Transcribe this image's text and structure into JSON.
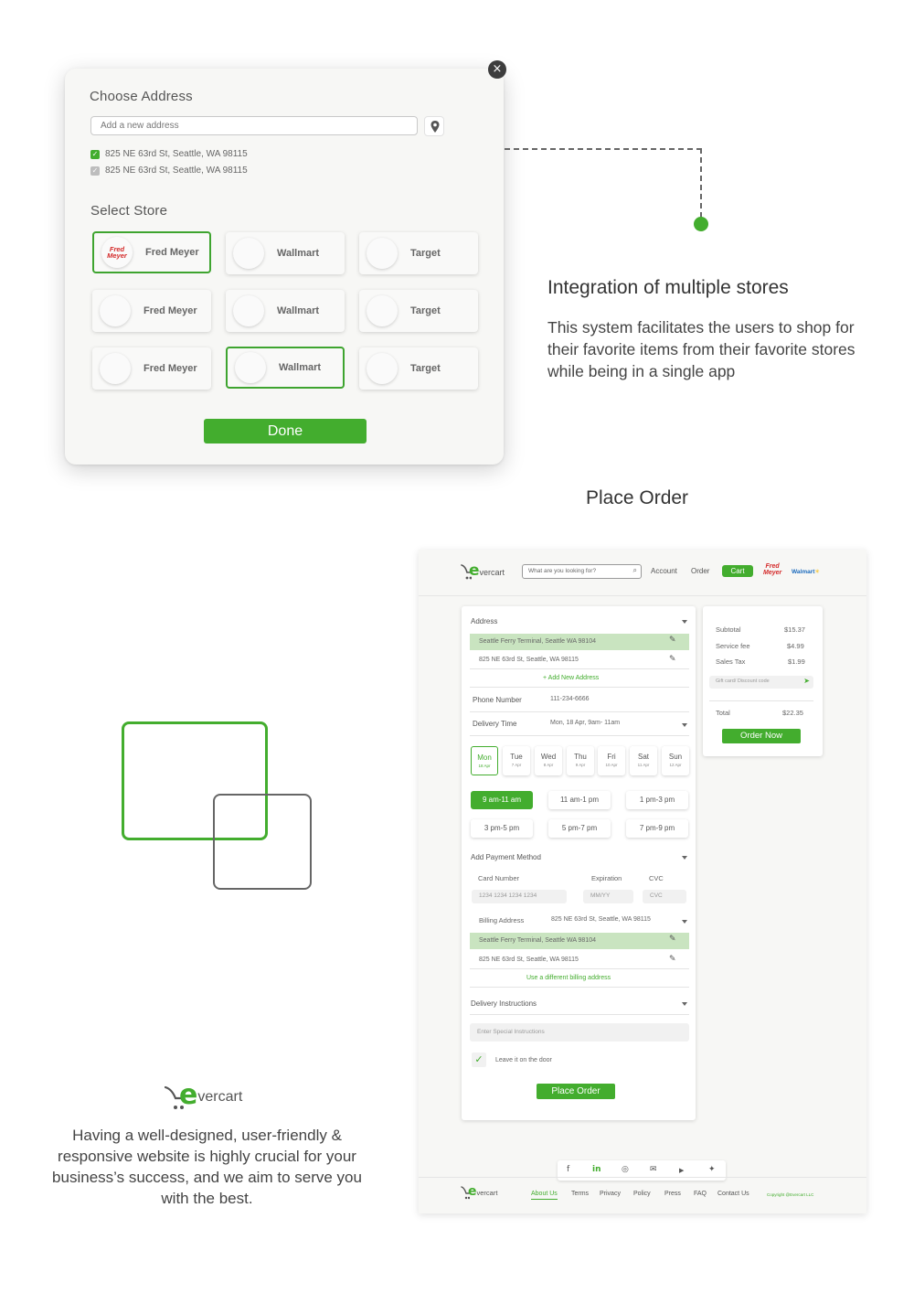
{
  "modal": {
    "close_glyph": "×",
    "choose_address_title": "Choose Address",
    "address_placeholder": "Add a new address",
    "addresses": [
      {
        "text": "825 NE 63rd St, Seattle, WA 98115",
        "checked": true
      },
      {
        "text": "825 NE 63rd St, Seattle, WA 98115",
        "checked": false
      }
    ],
    "select_store_title": "Select Store",
    "stores": [
      {
        "name": "Fred Meyer",
        "selected": true,
        "logo_top": "Fred",
        "logo_bottom": "Meyer"
      },
      {
        "name": "Wallmart",
        "selected": false
      },
      {
        "name": "Target",
        "selected": false
      },
      {
        "name": "Fred Meyer",
        "selected": false
      },
      {
        "name": "Wallmart",
        "selected": false
      },
      {
        "name": "Target",
        "selected": false
      },
      {
        "name": "Fred Meyer",
        "selected": false
      },
      {
        "name": "Wallmart",
        "selected": true
      },
      {
        "name": "Target",
        "selected": false
      }
    ],
    "done_label": "Done"
  },
  "feature": {
    "title": "Integration of multiple stores",
    "description": "This system facilitates the users to shop for their favorite items from their favorite stores while being in a single app"
  },
  "section_title": "Place Order",
  "brand": {
    "logo_e": "e",
    "logo_rest": "vercart",
    "accent_color": "#43ad2e"
  },
  "tagline": "Having a well-designed, user-friendly & responsive website is highly crucial for your business’s success, and we aim to serve you with the best.",
  "order_page": {
    "header": {
      "search_placeholder": "What are you looking for?",
      "nav_account": "Account",
      "nav_order": "Order",
      "nav_cart": "Cart",
      "fred_top": "Fred",
      "fred_bottom": "Meyer",
      "walmart": "Walmart"
    },
    "address": {
      "title": "Address",
      "selected": "Seattle Ferry Terminal, Seattle WA 98104",
      "other": "825 NE 63rd St, Seattle, WA 98115",
      "add_new": "+ Add New Address"
    },
    "phone": {
      "label": "Phone Number",
      "value": "111-234-6666"
    },
    "delivery_time": {
      "label": "Delivery Time",
      "value": "Mon, 18 Apr, 9am- 11am"
    },
    "days": [
      {
        "name": "Mon",
        "date": "18 Apr",
        "selected": true
      },
      {
        "name": "Tue",
        "date": "7 Apr",
        "selected": false
      },
      {
        "name": "Wed",
        "date": "8 Apr",
        "selected": false
      },
      {
        "name": "Thu",
        "date": "9 Apr",
        "selected": false
      },
      {
        "name": "Fri",
        "date": "10 Apr",
        "selected": false
      },
      {
        "name": "Sat",
        "date": "11 Apr",
        "selected": false
      },
      {
        "name": "Sun",
        "date": "12 Apr",
        "selected": false
      }
    ],
    "slots": [
      {
        "label": "9 am-11 am",
        "selected": true
      },
      {
        "label": "11 am-1 pm",
        "selected": false
      },
      {
        "label": "1 pm-3 pm",
        "selected": false
      },
      {
        "label": "3 pm-5 pm",
        "selected": false
      },
      {
        "label": "5 pm-7 pm",
        "selected": false
      },
      {
        "label": "7 pm-9 pm",
        "selected": false
      }
    ],
    "payment": {
      "title": "Add Payment Method",
      "card_label": "Card  Number",
      "card_placeholder": "1234 1234 1234 1234",
      "exp_label": "Expiration",
      "exp_placeholder": "MM/YY",
      "cvc_label": "CVC",
      "cvc_placeholder": "CVC",
      "billing_label": "Billing Address",
      "billing_value": "825 NE 63rd St, Seattle, WA 98115",
      "billing_selected": "Seattle Ferry Terminal, Seattle WA 98104",
      "billing_other": "825 NE 63rd St, Seattle, WA 98115",
      "billing_link": "Use a different billing address"
    },
    "instructions": {
      "title": "Delivery Instructions",
      "placeholder": "Enter Special Instructions",
      "leave_door": "Leave it on the door",
      "leave_door_checked": true
    },
    "place_order": "Place Order",
    "summary": {
      "subtotal_label": "Subtotal",
      "subtotal": "$15.37",
      "service_label": "Service fee",
      "service": "$4.99",
      "tax_label": "Sales Tax",
      "tax": "$1.99",
      "gift_placeholder": "Gift card/ Discount code",
      "total_label": "Total",
      "total": "$22.35",
      "order_now": "Order Now"
    },
    "social": [
      "f",
      "in",
      "◎",
      "✉",
      "▶",
      "✦"
    ],
    "footer": {
      "links": [
        "About Us",
        "Terms",
        "Privacy",
        "Policy",
        "Press",
        "FAQ",
        "Contact Us"
      ],
      "copyright": "Copyright @Evercart LLC"
    }
  }
}
